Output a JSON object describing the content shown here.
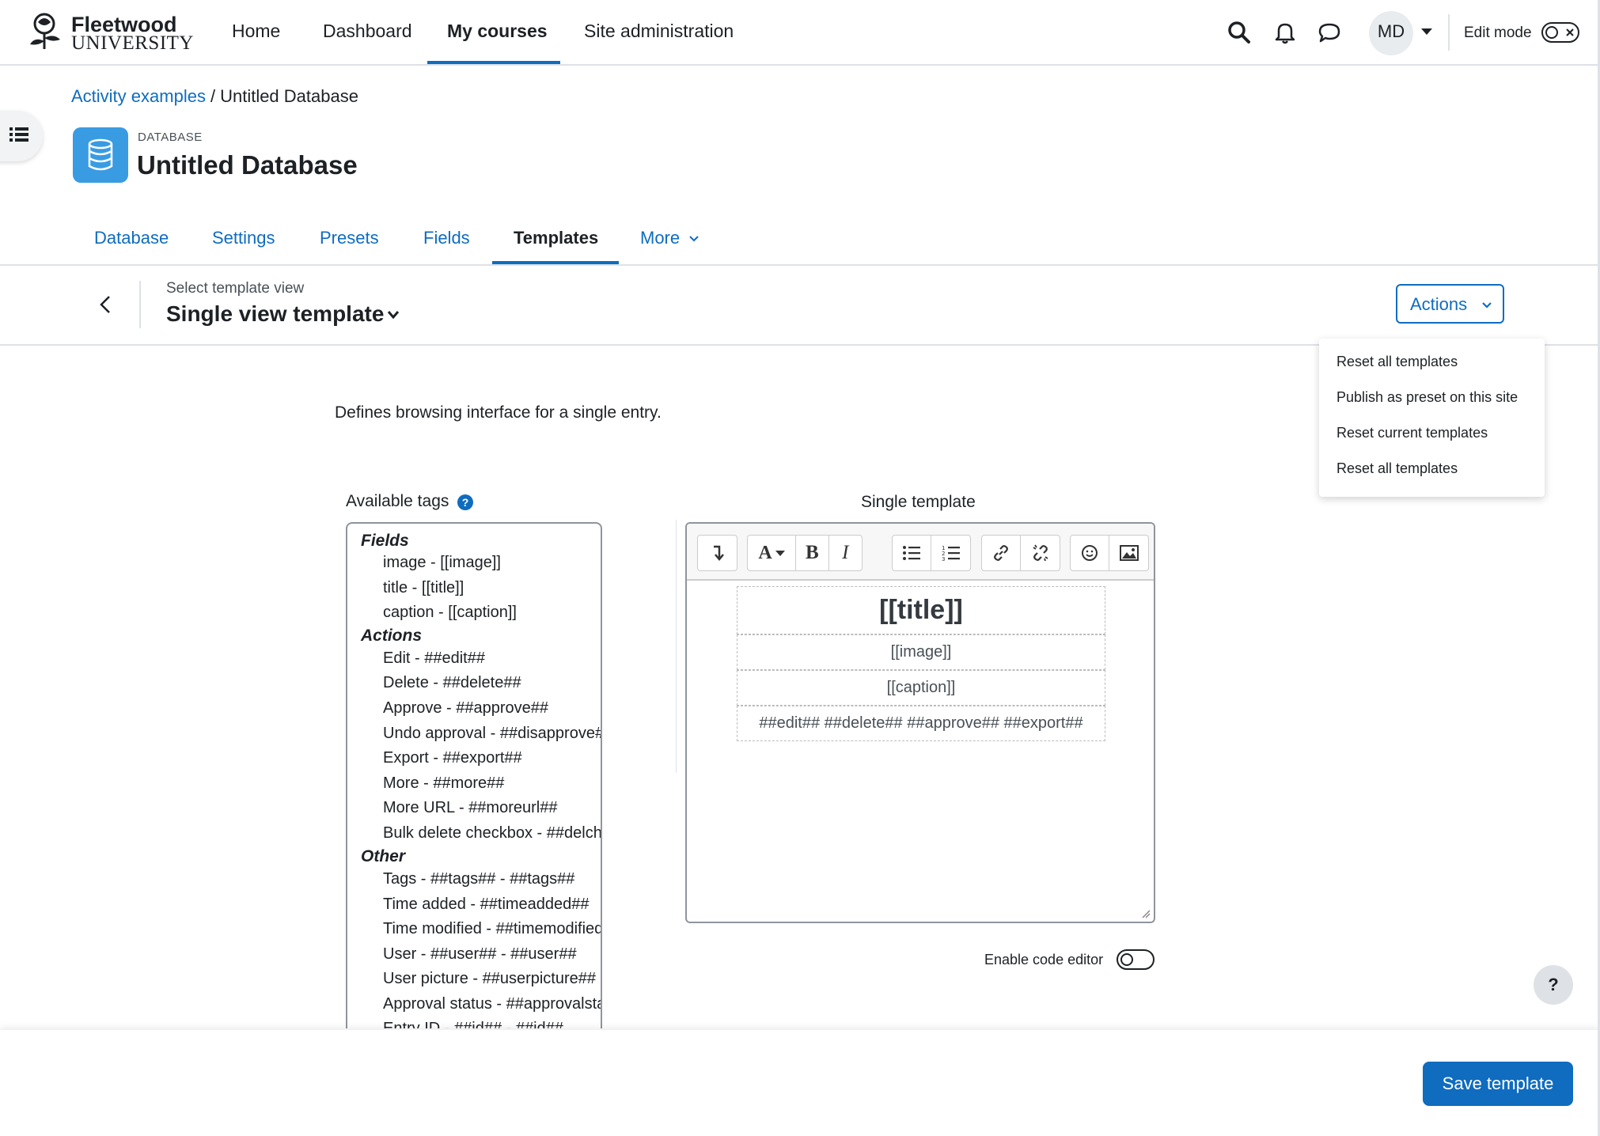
{
  "brand": {
    "name_line1": "Fleetwood",
    "name_line2": "UNIVERSITY"
  },
  "nav": {
    "items": [
      {
        "label": "Home"
      },
      {
        "label": "Dashboard"
      },
      {
        "label": "My courses"
      },
      {
        "label": "Site administration"
      }
    ],
    "active": "My courses"
  },
  "user": {
    "initials": "MD"
  },
  "edit_mode": {
    "label": "Edit mode",
    "enabled": false
  },
  "breadcrumb": {
    "parent": "Activity examples",
    "separator": "/",
    "current": "Untitled Database"
  },
  "header": {
    "module_type": "DATABASE",
    "title": "Untitled Database"
  },
  "secondary_nav": {
    "items": [
      {
        "label": "Database"
      },
      {
        "label": "Settings"
      },
      {
        "label": "Presets"
      },
      {
        "label": "Fields"
      },
      {
        "label": "Templates"
      },
      {
        "label": "More"
      }
    ],
    "active": "Templates"
  },
  "template_selector": {
    "caption": "Select template view",
    "selected": "Single view template"
  },
  "actions": {
    "label": "Actions",
    "menu": [
      {
        "label": "Reset all templates"
      },
      {
        "label": "Publish as preset on this site"
      },
      {
        "label": "Reset current templates"
      },
      {
        "label": "Reset all templates"
      }
    ]
  },
  "description": "Defines browsing interface for a single entry.",
  "available_tags": {
    "label": "Available tags",
    "fields_heading": "Fields",
    "fields": [
      "image - [[image]]",
      "title - [[title]]",
      "caption - [[caption]]"
    ],
    "actions_heading": "Actions",
    "actions": [
      "Edit - ##edit##",
      "Delete - ##delete##",
      "Approve - ##approve##",
      "Undo approval - ##disapprove##",
      "Export - ##export##",
      "More - ##more##",
      "More URL - ##moreurl##",
      "Bulk delete checkbox - ##delcheck##"
    ],
    "other_heading": "Other",
    "other": [
      "Tags - ##tags## - ##tags##",
      "Time added - ##timeadded##",
      "Time modified - ##timemodified##",
      "User - ##user## - ##user##",
      "User picture - ##userpicture##",
      "Approval status - ##approvalstatus##",
      "Entry ID - ##id## - ##id##"
    ]
  },
  "editor": {
    "label": "Single template",
    "content": {
      "title": "[[title]]",
      "image": "[[image]]",
      "caption": "[[caption]]",
      "actions": "##edit## ##delete## ##approve## ##export##"
    },
    "toolbar_icons": [
      "collapse-icon",
      "font-style-icon",
      "bold-icon",
      "italic-icon",
      "unordered-list-icon",
      "ordered-list-icon",
      "link-icon",
      "unlink-icon",
      "emoji-icon",
      "image-icon"
    ]
  },
  "code_editor": {
    "label": "Enable code editor",
    "enabled": false
  },
  "help": {
    "label": "?"
  },
  "save": {
    "label": "Save template"
  },
  "colors": {
    "primary": "#0f6cbf",
    "module_icon": "#399be2",
    "text": "#1d2125"
  }
}
